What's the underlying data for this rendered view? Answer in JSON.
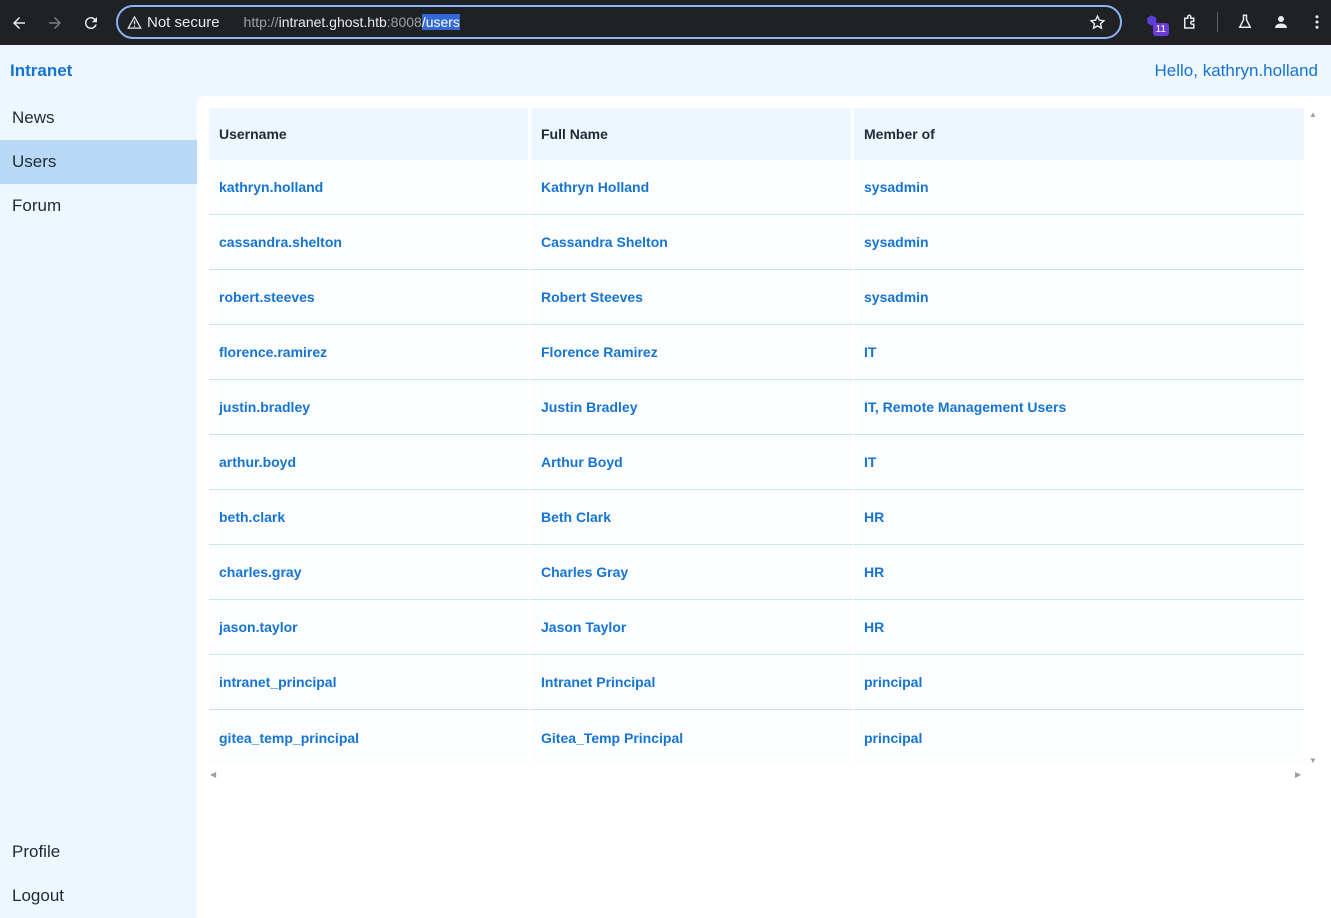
{
  "browser": {
    "security_label": "Not secure",
    "url_scheme": "http://",
    "url_host": "intranet.ghost.htb",
    "url_port": ":8008",
    "url_path": "/users",
    "extension_badge": "11"
  },
  "header": {
    "brand": "Intranet",
    "greeting": "Hello, kathryn.holland"
  },
  "sidebar": {
    "items": [
      {
        "label": "News"
      },
      {
        "label": "Users"
      },
      {
        "label": "Forum"
      }
    ],
    "bottom_items": [
      {
        "label": "Profile"
      },
      {
        "label": "Logout"
      }
    ]
  },
  "users_table": {
    "columns": [
      "Username",
      "Full Name",
      "Member of"
    ],
    "rows": [
      {
        "username": "kathryn.holland",
        "full_name": "Kathryn Holland",
        "member_of": "sysadmin"
      },
      {
        "username": "cassandra.shelton",
        "full_name": "Cassandra Shelton",
        "member_of": "sysadmin"
      },
      {
        "username": "robert.steeves",
        "full_name": "Robert Steeves",
        "member_of": "sysadmin"
      },
      {
        "username": "florence.ramirez",
        "full_name": "Florence Ramirez",
        "member_of": "IT"
      },
      {
        "username": "justin.bradley",
        "full_name": "Justin Bradley",
        "member_of": "IT, Remote Management Users"
      },
      {
        "username": "arthur.boyd",
        "full_name": "Arthur Boyd",
        "member_of": "IT"
      },
      {
        "username": "beth.clark",
        "full_name": "Beth Clark",
        "member_of": "HR"
      },
      {
        "username": "charles.gray",
        "full_name": "Charles Gray",
        "member_of": "HR"
      },
      {
        "username": "jason.taylor",
        "full_name": "Jason Taylor",
        "member_of": "HR"
      },
      {
        "username": "intranet_principal",
        "full_name": "Intranet Principal",
        "member_of": "principal"
      },
      {
        "username": "gitea_temp_principal",
        "full_name": "Gitea_Temp Principal",
        "member_of": "principal"
      }
    ]
  },
  "colors": {
    "accent": "#1674d2",
    "sidebar_active": "#b9d9f6",
    "page_background": "#eef6ff",
    "browser_chrome": "#202124"
  }
}
